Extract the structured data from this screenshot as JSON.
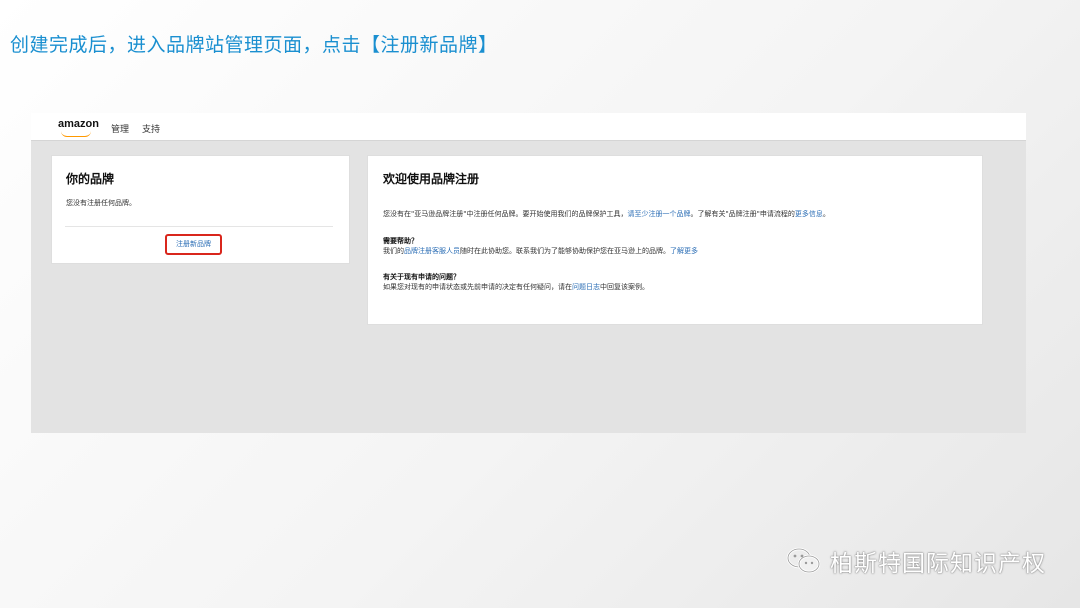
{
  "slide": {
    "instruction": "创建完成后，进入品牌站管理页面，点击【注册新品牌】"
  },
  "header": {
    "logo": "amazon",
    "nav": [
      "管理",
      "支持"
    ]
  },
  "brands_card": {
    "heading": "你的品牌",
    "empty_text": "您没有注册任何品牌。",
    "register_link": "注册新品牌"
  },
  "welcome_card": {
    "heading": "欢迎使用品牌注册",
    "intro_text": "您没有在\"亚马逊品牌注册\"中注册任何品牌。要开始使用我们的品牌保护工具，",
    "intro_link1": "请至少注册一个品牌",
    "intro_mid": "。了解有关\"品牌注册\"申请流程的",
    "intro_link2": "更多信息",
    "intro_end": "。",
    "help_title": "需要帮助？",
    "help_pre": "我们的",
    "help_link1": "品牌注册客服人员",
    "help_mid": "随时在此协助您。联系我们为了能够协助保护您在亚马逊上的品牌。",
    "help_link2": "了解更多",
    "question_title": "有关于现有申请的问题？",
    "question_pre": "如果您对现有的申请状态或先前申请的决定有任何疑问，请在",
    "question_link": "问题日志",
    "question_end": "中回复该案例。"
  },
  "watermark": {
    "text": "柏斯特国际知识产权",
    "icon": "wechat-icon"
  },
  "colors": {
    "title_blue": "#1a8fd0",
    "link_blue": "#2a6db5",
    "highlight_red": "#d9261c",
    "amazon_orange": "#ff9900"
  }
}
